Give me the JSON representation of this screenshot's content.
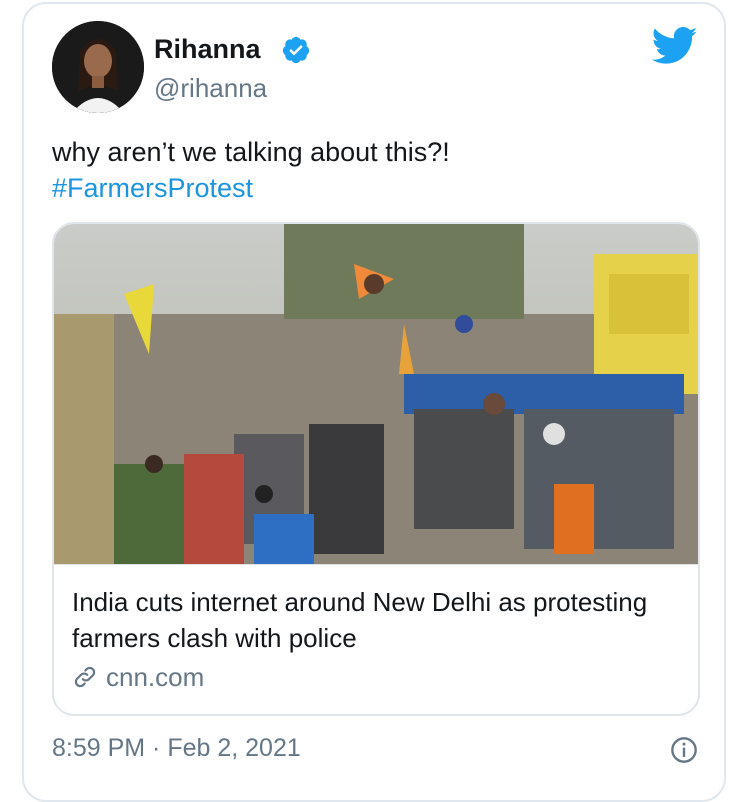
{
  "author": {
    "name": "Rihanna",
    "handle": "@rihanna",
    "verified": true,
    "avatar_icon": "profile-photo"
  },
  "tweet": {
    "text": "why aren’t we talking about this?!",
    "hashtag": "#FarmersProtest"
  },
  "link_card": {
    "image_icon": "farmers-protest-photo",
    "headline": "India cuts internet around New Delhi as protesting farmers clash with police",
    "domain": "cnn.com"
  },
  "meta": {
    "timestamp": "8:59 PM · Feb 2, 2021"
  },
  "colors": {
    "brand_blue": "#1da1f2",
    "link_blue": "#1b95e0",
    "text": "#14171a",
    "secondary_text": "#657786",
    "border": "#e1e8ed"
  }
}
